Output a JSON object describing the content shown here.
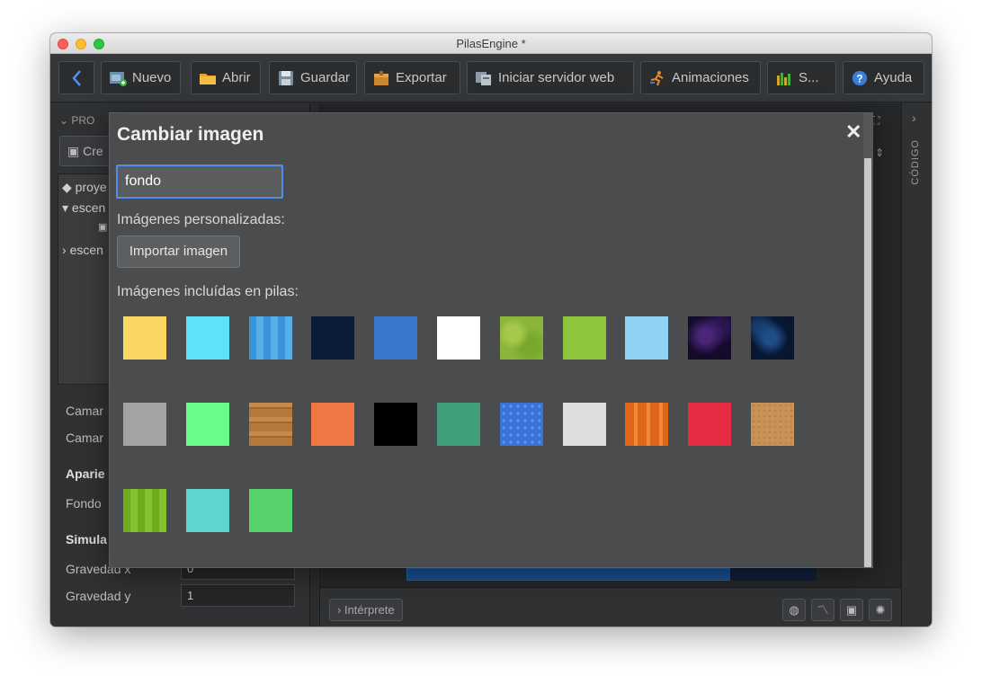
{
  "window": {
    "title": "PilasEngine *"
  },
  "toolbar": {
    "back_icon": "chevron-left-icon",
    "buttons": [
      {
        "label": "Nuevo",
        "icon": "new-image-icon"
      },
      {
        "label": "Abrir",
        "icon": "folder-icon"
      },
      {
        "label": "Guardar",
        "icon": "floppy-icon"
      },
      {
        "label": "Exportar",
        "icon": "package-icon"
      },
      {
        "label": "Iniciar servidor web",
        "icon": "server-icon"
      },
      {
        "label": "Animaciones",
        "icon": "runner-icon"
      },
      {
        "label": "S...",
        "icon": "equalizer-icon"
      },
      {
        "label": "Ayuda",
        "icon": "help-icon"
      }
    ]
  },
  "left_panel": {
    "title": "PRO",
    "create_label": "Cre",
    "tree": [
      "proye",
      "escen",
      "escen"
    ],
    "props": {
      "camara_1": "Camar",
      "camara_2": "Camar",
      "apariencia": "Aparie",
      "fondo": "Fondo",
      "simulacion": "Simula",
      "gravedad_x_label": "Gravedad x",
      "gravedad_x_value": "0",
      "gravedad_y_label": "Gravedad y",
      "gravedad_y_value": "1"
    }
  },
  "center": {
    "interprete_label": "Intérprete",
    "bottom_icons": [
      "globe-icon",
      "chart-icon",
      "image-icon",
      "settings-icon"
    ]
  },
  "right_panel": {
    "label": "CÓDIGO"
  },
  "modal": {
    "title": "Cambiar imagen",
    "close_symbol": "✕",
    "search_value": "fondo",
    "custom_label": "Imágenes personalizadas:",
    "import_label": "Importar imagen",
    "included_label": "Imágenes incluídas en pilas:",
    "tiles": [
      {
        "name": "fondo-amarillo",
        "color": "#fad663"
      },
      {
        "name": "fondo-celeste",
        "color": "#5fe0fb"
      },
      {
        "name": "fondo-azul-rayas",
        "color": "#3a94d9"
      },
      {
        "name": "fondo-azul-oscuro",
        "color": "#0b1c3b"
      },
      {
        "name": "fondo-azul",
        "color": "#3a78d0"
      },
      {
        "name": "fondo-blanco",
        "color": "#ffffff"
      },
      {
        "name": "fondo-pasto",
        "color": "#8ab43a"
      },
      {
        "name": "fondo-verde-lima",
        "color": "#8cc63c"
      },
      {
        "name": "fondo-celeste-claro",
        "color": "#8fd3f3"
      },
      {
        "name": "fondo-espacio-violeta",
        "color": "#1a0f33"
      },
      {
        "name": "fondo-espacio-azul",
        "color": "#0b1b3a"
      },
      {
        "name": "fondo-gris",
        "color": "#a3a3a3"
      },
      {
        "name": "fondo-verde-claro",
        "color": "#6bfb8d"
      },
      {
        "name": "fondo-madera",
        "color": "#b47a3c"
      },
      {
        "name": "fondo-naranja",
        "color": "#ef7746"
      },
      {
        "name": "fondo-negro",
        "color": "#000000"
      },
      {
        "name": "fondo-verde-mar",
        "color": "#419e7a"
      },
      {
        "name": "fondo-azul-borde",
        "color": "#3a72d8"
      },
      {
        "name": "fondo-gris-claro",
        "color": "#dedede"
      },
      {
        "name": "fondo-naranja-rayas",
        "color": "#e0671a"
      },
      {
        "name": "fondo-rojo",
        "color": "#e82c45"
      },
      {
        "name": "fondo-arena",
        "color": "#c99358"
      },
      {
        "name": "fondo-verde-rayas",
        "color": "#6fac1e"
      },
      {
        "name": "fondo-turquesa",
        "color": "#5fd6cd"
      },
      {
        "name": "fondo-verde",
        "color": "#55d26b"
      }
    ]
  }
}
